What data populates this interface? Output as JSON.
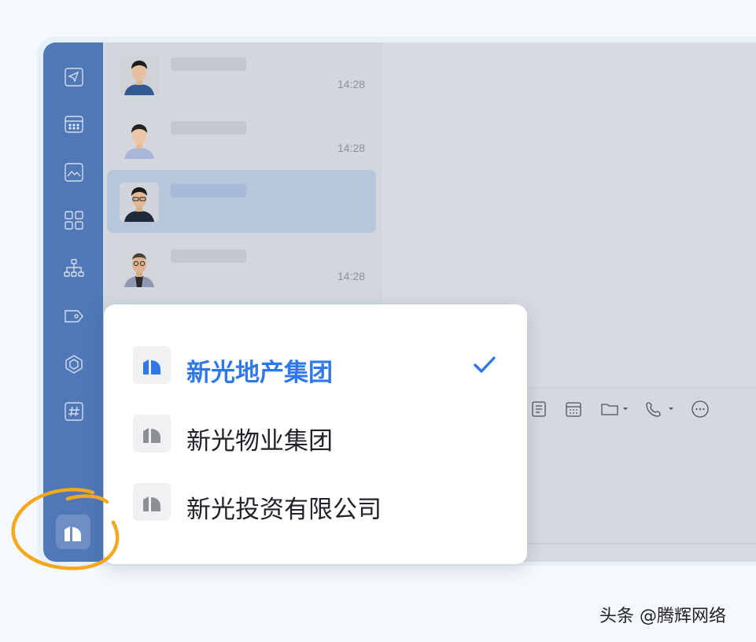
{
  "sidebar": {
    "icons": [
      "nav-location-icon",
      "calendar-icon",
      "photo-icon",
      "apps-grid-icon",
      "org-chart-icon",
      "tag-icon",
      "cube-icon",
      "hashtag-icon"
    ]
  },
  "chats": [
    {
      "name": "",
      "time": "14:28"
    },
    {
      "name": "",
      "time": "14:28"
    },
    {
      "name": "",
      "time": ""
    },
    {
      "name": "",
      "time": "14:28"
    }
  ],
  "toolbar": {
    "icons": [
      "document-icon",
      "calendar-icon",
      "folder-icon",
      "phone-icon",
      "more-icon"
    ]
  },
  "org_menu": {
    "selected_index": 0,
    "items": [
      {
        "label": "新光地产集团"
      },
      {
        "label": "新光物业集团"
      },
      {
        "label": "新光投资有限公司"
      }
    ]
  },
  "colors": {
    "sidebar": "#5078b6",
    "accent": "#2f78e6",
    "highlight_circle": "#f5a81c"
  },
  "watermark": "头条 @腾辉网络"
}
